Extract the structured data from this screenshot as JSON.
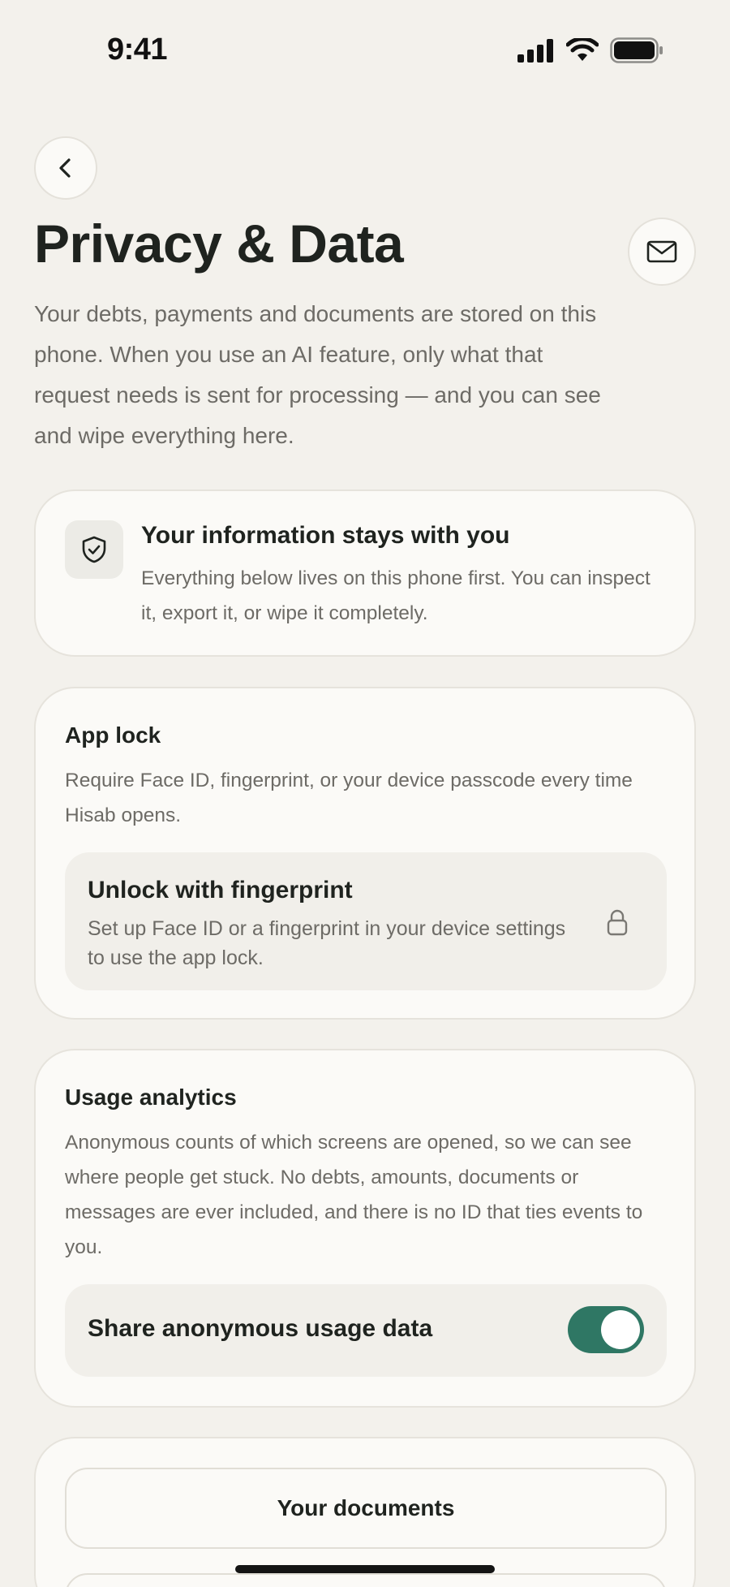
{
  "status_bar": {
    "time": "9:41"
  },
  "header": {
    "title": "Privacy & Data"
  },
  "intro": "Your debts, payments and documents are stored on this phone. When you use an AI feature, only what that request needs is sent for processing — and you can see and wipe everything here.",
  "info_card": {
    "title": "Your information stays with you",
    "body": "Everything below lives on this phone first. You can inspect it, export it, or wipe it completely."
  },
  "app_lock": {
    "title": "App lock",
    "body": "Require Face ID, fingerprint, or your device passcode every time Hisab opens.",
    "option_title": "Unlock with fingerprint",
    "option_body": "Set up Face ID or a fingerprint in your device settings to use the app lock."
  },
  "analytics": {
    "title": "Usage analytics",
    "body": "Anonymous counts of which screens are opened, so we can see where people get stuck. No debts, amounts, documents or messages are ever included, and there is no ID that ties events to you.",
    "toggle_label": "Share anonymous usage data",
    "toggle_on": true
  },
  "documents": {
    "button_label": "Your documents"
  },
  "colors": {
    "background": "#f3f1ec",
    "accent": "#2f7764",
    "card": "#fbfaf7"
  },
  "icons": [
    "back-chevron-icon",
    "mail-icon",
    "shield-check-icon",
    "lock-icon",
    "signal-icon",
    "wifi-icon",
    "battery-icon"
  ]
}
